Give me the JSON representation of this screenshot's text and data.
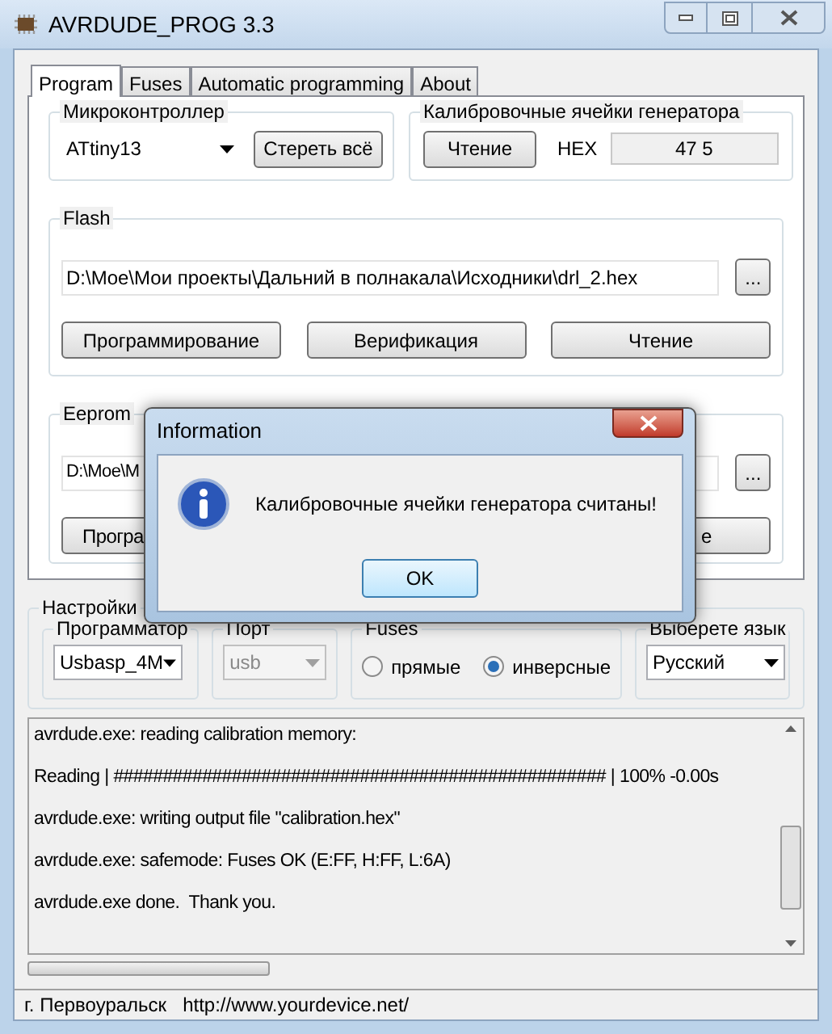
{
  "window": {
    "title": "AVRDUDE_PROG 3.3"
  },
  "tabs": [
    {
      "label": "Program",
      "selected": true
    },
    {
      "label": "Fuses",
      "selected": false
    },
    {
      "label": "Automatic programming",
      "selected": false
    },
    {
      "label": "About",
      "selected": false
    }
  ],
  "microcontroller": {
    "title": "Микроконтроллер",
    "value": "ATtiny13",
    "erase_button": "Стереть всё"
  },
  "calibration": {
    "title": "Калибровочные ячейки генератора",
    "read_button": "Чтение",
    "hex_label": "HEX",
    "hex_value": "47 5"
  },
  "flash": {
    "title": "Flash",
    "path": "D:\\Moe\\Мои проекты\\Дальний в полнакала\\Исходники\\drl_2.hex",
    "browse_button": "...",
    "buttons": [
      "Программирование",
      "Верификация",
      "Чтение"
    ]
  },
  "eeprom": {
    "title": "Eeprom",
    "path": "D:\\Moe\\M",
    "browse_button": "...",
    "buttons": [
      "Програ",
      "е"
    ]
  },
  "settings": {
    "title": "Настройки",
    "programmer": {
      "title": "Программатор",
      "value": "Usbasp_4M",
      "disabled": false
    },
    "port": {
      "title": "Порт",
      "value": "usb",
      "disabled": true
    },
    "fuses": {
      "title": "Fuses",
      "options": [
        {
          "label": "прямые",
          "selected": false
        },
        {
          "label": "инверсные",
          "selected": true
        }
      ]
    },
    "language": {
      "title": "Выберете язык",
      "value": "Русский",
      "disabled": false
    }
  },
  "log": [
    "avrdude.exe: reading calibration memory:",
    "Reading | ################################################## | 100% -0.00s",
    "avrdude.exe: writing output file \"calibration.hex\"",
    "avrdude.exe: safemode: Fuses OK (E:FF, H:FF, L:6A)",
    "avrdude.exe done.  Thank you."
  ],
  "status_bar": [
    "г. Первоуральск",
    "http://www.yourdevice.net/"
  ],
  "dialog": {
    "title": "Information",
    "message": "Калибровочные ячейки генератора считаны!",
    "ok_button": "OK"
  }
}
